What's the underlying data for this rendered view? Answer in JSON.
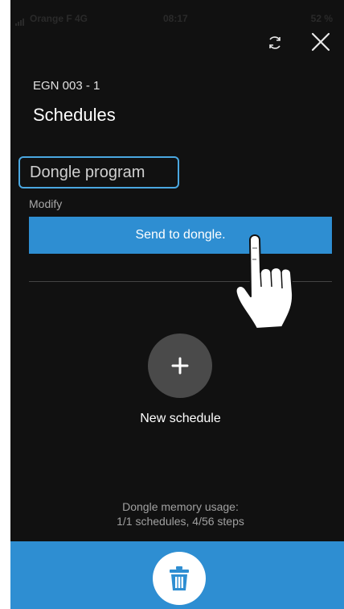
{
  "status_bar": {
    "carrier": "Orange F  4G",
    "time": "08:17",
    "battery": "52 %"
  },
  "header": {
    "subtitle": "EGN 003 - 1",
    "title": "Schedules"
  },
  "program": {
    "name": "Dongle program",
    "modify_label": "Modify",
    "send_label": "Send to dongle."
  },
  "new_schedule": {
    "label": "New schedule"
  },
  "memory": {
    "line1": "Dongle memory usage:",
    "line2": "1/1 schedules, 4/56 steps"
  },
  "icons": {
    "refresh": "refresh-icon",
    "close": "close-icon",
    "add": "plus-icon",
    "delete": "trash-icon",
    "pointer": "hand-pointer-icon"
  },
  "colors": {
    "accent": "#2e8ed2",
    "background": "#111111",
    "input_border": "#4aa7e0"
  }
}
